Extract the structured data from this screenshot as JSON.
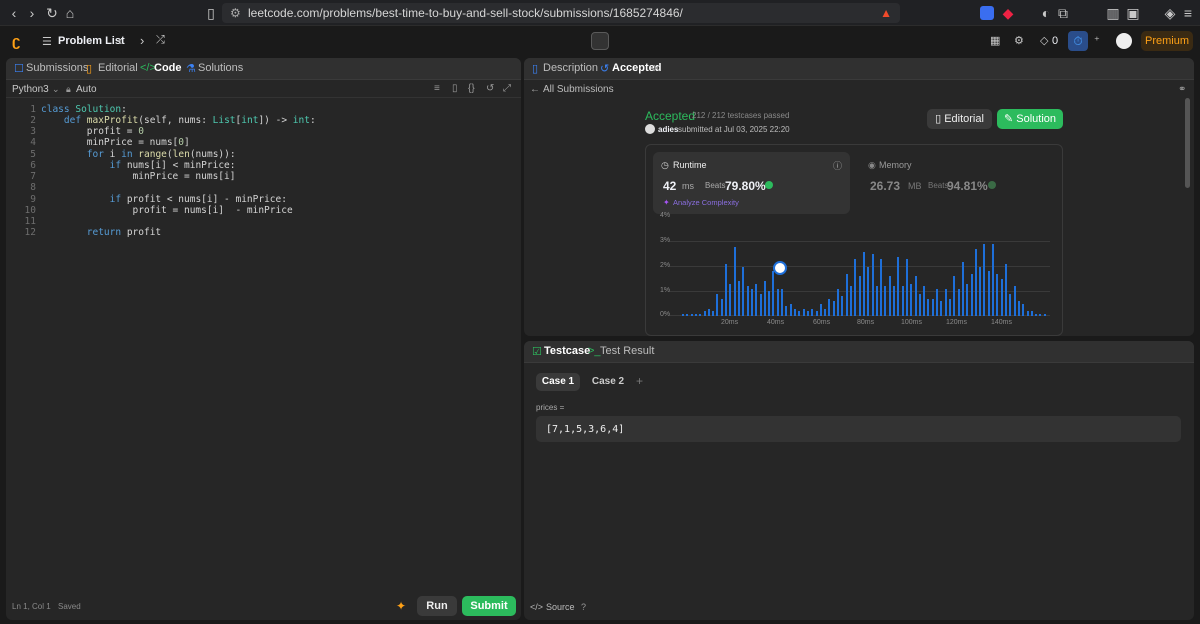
{
  "browser": {
    "url": "leetcode.com/problems/best-time-to-buy-and-sell-stock/submissions/1685274846/"
  },
  "nav": {
    "problem_list": "Problem List",
    "streak": "0",
    "premium": "Premium"
  },
  "left": {
    "tabs": [
      "Submissions",
      "Editorial",
      "Code",
      "Solutions"
    ],
    "language": "Python3",
    "auto": "Auto",
    "code_lines": [
      "1",
      "2",
      "3",
      "4",
      "5",
      "6",
      "7",
      "8",
      "9",
      "10",
      "11",
      "12"
    ],
    "status": {
      "position": "Ln 1, Col 1",
      "saved": "Saved"
    },
    "run": "Run",
    "submit": "Submit"
  },
  "right": {
    "tabs": [
      "Description",
      "Accepted"
    ],
    "back": "All Submissions",
    "result": {
      "status": "Accepted",
      "passed": "212 / 212 testcases passed",
      "user": "adies",
      "submitted": "submitted at Jul 03, 2025 22:20",
      "editorial": "Editorial",
      "solution": "Solution"
    },
    "runtime": {
      "label": "Runtime",
      "value": "42",
      "unit": "ms",
      "beats_label": "Beats",
      "beats": "79.80%",
      "analyze": "Analyze Complexity"
    },
    "memory": {
      "label": "Memory",
      "value": "26.73",
      "unit": "MB",
      "beats_label": "Beats",
      "beats": "94.81%"
    },
    "testcase_tab": "Testcase",
    "testresult_tab": "Test Result",
    "cases": [
      "Case 1",
      "Case 2"
    ],
    "input_label": "prices =",
    "input_value": "[7,1,5,3,6,4]",
    "source": "Source"
  },
  "chart_data": {
    "type": "bar",
    "ylabel_ticks": [
      "4%",
      "3%",
      "2%",
      "1%",
      "0%"
    ],
    "xlabel_ticks": [
      "20ms",
      "40ms",
      "60ms",
      "80ms",
      "100ms",
      "120ms",
      "140ms"
    ],
    "ylim": [
      0,
      4
    ],
    "highlight_x": "42ms",
    "values": [
      0.1,
      0.1,
      0.1,
      0.1,
      0.1,
      0.2,
      0.3,
      0.2,
      0.9,
      0.7,
      2.1,
      1.3,
      2.8,
      1.4,
      2.0,
      1.2,
      1.1,
      1.3,
      0.9,
      1.4,
      1.0,
      1.8,
      1.1,
      1.1,
      0.4,
      0.5,
      0.3,
      0.2,
      0.3,
      0.2,
      0.3,
      0.2,
      0.5,
      0.3,
      0.7,
      0.6,
      1.1,
      0.8,
      1.7,
      1.2,
      2.3,
      1.6,
      2.6,
      2.0,
      2.5,
      1.2,
      2.3,
      1.2,
      1.6,
      1.2,
      2.4,
      1.2,
      2.3,
      1.3,
      1.6,
      0.9,
      1.2,
      0.7,
      0.7,
      1.1,
      0.6,
      1.1,
      0.7,
      1.6,
      1.1,
      2.2,
      1.3,
      1.7,
      2.7,
      2.0,
      2.9,
      1.8,
      2.9,
      1.7,
      1.5,
      2.1,
      0.9,
      1.2,
      0.6,
      0.5,
      0.2,
      0.2,
      0.1,
      0.1,
      0.1
    ]
  }
}
